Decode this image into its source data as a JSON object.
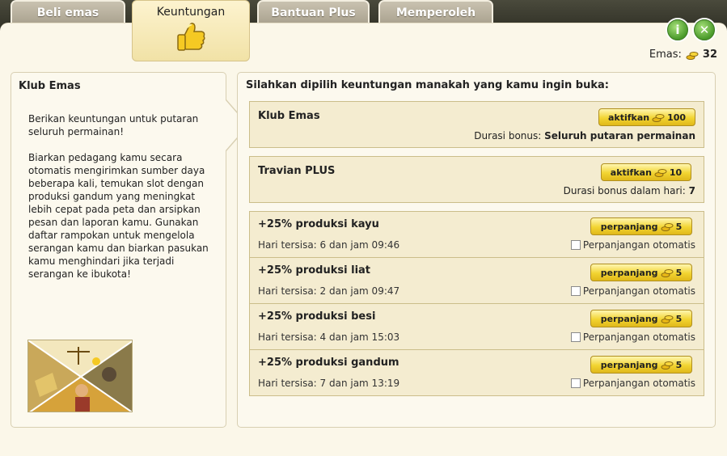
{
  "tabs": [
    {
      "label": "Beli emas"
    },
    {
      "label": "Keuntungan"
    },
    {
      "label": "Bantuan Plus"
    },
    {
      "label": "Memperoleh Emas"
    }
  ],
  "header": {
    "emas_label": "Emas:",
    "emas_value": "32"
  },
  "left": {
    "title": "Klub Emas",
    "para1": "Berikan keuntungan untuk putaran seluruh permainan!",
    "para2": "Biarkan pedagang kamu secara otomatis mengirimkan sumber daya beberapa kali, temukan slot dengan produksi gandum yang meningkat lebih cepat pada peta dan arsipkan pesan dan laporan kamu. Gunakan daftar rampokan untuk mengelola serangan kamu dan biarkan pasukan kamu menghindari jika terjadi serangan ke ibukota!"
  },
  "right": {
    "heading": "Silahkan dipilih keuntungan manakah yang kamu ingin buka:",
    "gold_club": {
      "title": "Klub Emas",
      "button": "aktifkan",
      "cost": "100",
      "duration_label": "Durasi bonus:",
      "duration_value": "Seluruh putaran permainan"
    },
    "plus": {
      "title": "Travian PLUS",
      "button": "aktifkan",
      "cost": "10",
      "duration_label": "Durasi bonus dalam hari:",
      "duration_value": "7"
    },
    "boosts": [
      {
        "title": "+25% produksi kayu",
        "remaining": "Hari tersisa: 6 dan jam 09:46",
        "button": "perpanjang",
        "cost": "5",
        "auto": "Perpanjangan otomatis"
      },
      {
        "title": "+25% produksi liat",
        "remaining": "Hari tersisa: 2 dan jam 09:47",
        "button": "perpanjang",
        "cost": "5",
        "auto": "Perpanjangan otomatis"
      },
      {
        "title": "+25% produksi besi",
        "remaining": "Hari tersisa: 4 dan jam 15:03",
        "button": "perpanjang",
        "cost": "5",
        "auto": "Perpanjangan otomatis"
      },
      {
        "title": "+25% produksi gandum",
        "remaining": "Hari tersisa: 7 dan jam 13:19",
        "button": "perpanjang",
        "cost": "5",
        "auto": "Perpanjangan otomatis"
      }
    ]
  },
  "icons": {
    "info": "info-icon",
    "close": "close-icon",
    "gold": "gold-coins-icon",
    "thumb": "thumbs-up-icon"
  },
  "colors": {
    "panel": "#fbf7e9",
    "card": "#f4ecd0",
    "gold_button": "#f2d431",
    "round_button": "#4a9a2a"
  }
}
